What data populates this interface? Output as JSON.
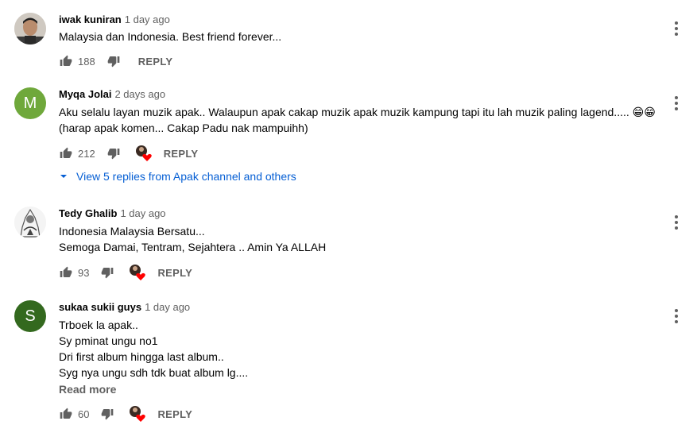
{
  "comments": [
    {
      "author": "iwak kuniran",
      "time": "1 day ago",
      "lines": [
        "Malaysia dan Indonesia. Best friend forever..."
      ],
      "likes": "188",
      "reply_label": "REPLY",
      "avatar_type": "photo",
      "hearted": false
    },
    {
      "author": "Myqa Jolai",
      "time": "2 days ago",
      "lines": [
        "Aku selalu layan muzik apak.. Walaupun apak cakap muzik apak muzik kampung tapi itu lah muzik paling lagend..... 😁😁",
        "(harap apak komen... Cakap Padu nak mampuihh)"
      ],
      "likes": "212",
      "reply_label": "REPLY",
      "avatar_letter": "M",
      "avatar_color": "#6fa83b",
      "hearted": true,
      "replies_label": "View 5 replies from Apak channel and others"
    },
    {
      "author": "Tedy Ghalib",
      "time": "1 day ago",
      "lines": [
        "Indonesia Malaysia Bersatu...",
        "Semoga Damai,  Tentram,  Sejahtera .. Amin Ya ALLAH"
      ],
      "likes": "93",
      "reply_label": "REPLY",
      "avatar_type": "sketch",
      "hearted": true
    },
    {
      "author": "sukaa sukii guys",
      "time": "1 day ago",
      "lines": [
        "Trboek la apak..",
        "Sy pminat ungu no1",
        "Dri first album hingga last album..",
        "Syg nya ungu sdh tdk buat album lg...."
      ],
      "read_more": "Read more",
      "likes": "60",
      "reply_label": "REPLY",
      "avatar_letter": "S",
      "avatar_color": "#33691e",
      "hearted": true
    }
  ],
  "icons": {
    "like": "thumb-up-icon",
    "dislike": "thumb-down-icon",
    "menu": "more-vert-icon",
    "heart": "creator-heart-icon",
    "expand": "chevron-down-icon"
  },
  "colors": {
    "link_blue": "#065fd4",
    "secondary_text": "#606060",
    "heart_red": "#ff0000"
  }
}
